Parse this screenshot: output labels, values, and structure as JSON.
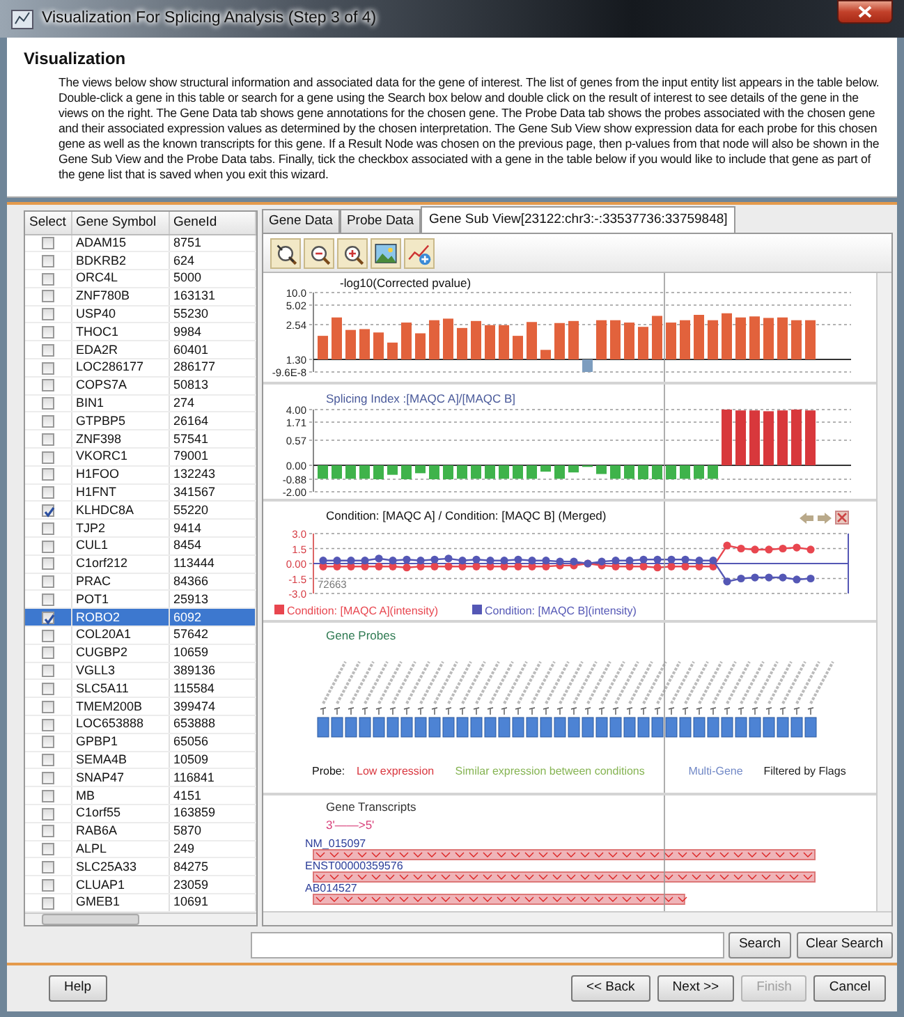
{
  "window": {
    "title": "Visualization For Splicing Analysis (Step 3 of 4)"
  },
  "header": {
    "title": "Visualization",
    "description": "The views below show structural information and associated data for the gene of interest. The list of genes from the input entity list appears in the table below. Double-click a gene in this table or search for a gene using the Search box below and double click on the result of interest to see details of the gene in the views on the right. The Gene Data tab shows gene annotations for the chosen gene. The Probe Data tab shows the probes associated with the chosen gene and their associated expression values as determined by the chosen interpretation. The Gene Sub View show expression data for each probe for this chosen gene as well as the known transcripts for this gene. If a Result Node was chosen on the previous page, then p-values from that node will also be shown in the Gene Sub View and the Probe Data tabs. Finally, tick the checkbox associated with a gene in the table below if you would like to include that gene as part of the gene list that is saved when you exit this wizard."
  },
  "gene_table": {
    "columns": [
      "Select",
      "Gene Symbol",
      "GeneId"
    ],
    "rows": [
      {
        "symbol": "ADAM15",
        "gene_id": "8751",
        "checked": false,
        "selected": false
      },
      {
        "symbol": "BDKRB2",
        "gene_id": "624",
        "checked": false,
        "selected": false
      },
      {
        "symbol": "ORC4L",
        "gene_id": "5000",
        "checked": false,
        "selected": false
      },
      {
        "symbol": "ZNF780B",
        "gene_id": "163131",
        "checked": false,
        "selected": false
      },
      {
        "symbol": "USP40",
        "gene_id": "55230",
        "checked": false,
        "selected": false
      },
      {
        "symbol": "THOC1",
        "gene_id": "9984",
        "checked": false,
        "selected": false
      },
      {
        "symbol": "EDA2R",
        "gene_id": "60401",
        "checked": false,
        "selected": false
      },
      {
        "symbol": "LOC286177",
        "gene_id": "286177",
        "checked": false,
        "selected": false
      },
      {
        "symbol": "COPS7A",
        "gene_id": "50813",
        "checked": false,
        "selected": false
      },
      {
        "symbol": "BIN1",
        "gene_id": "274",
        "checked": false,
        "selected": false
      },
      {
        "symbol": "GTPBP5",
        "gene_id": "26164",
        "checked": false,
        "selected": false
      },
      {
        "symbol": "ZNF398",
        "gene_id": "57541",
        "checked": false,
        "selected": false
      },
      {
        "symbol": "VKORC1",
        "gene_id": "79001",
        "checked": false,
        "selected": false
      },
      {
        "symbol": "H1FOO",
        "gene_id": "132243",
        "checked": false,
        "selected": false
      },
      {
        "symbol": "H1FNT",
        "gene_id": "341567",
        "checked": false,
        "selected": false
      },
      {
        "symbol": "KLHDC8A",
        "gene_id": "55220",
        "checked": true,
        "selected": false
      },
      {
        "symbol": "TJP2",
        "gene_id": "9414",
        "checked": false,
        "selected": false
      },
      {
        "symbol": "CUL1",
        "gene_id": "8454",
        "checked": false,
        "selected": false
      },
      {
        "symbol": "C1orf212",
        "gene_id": "113444",
        "checked": false,
        "selected": false
      },
      {
        "symbol": "PRAC",
        "gene_id": "84366",
        "checked": false,
        "selected": false
      },
      {
        "symbol": "POT1",
        "gene_id": "25913",
        "checked": false,
        "selected": false
      },
      {
        "symbol": "ROBO2",
        "gene_id": "6092",
        "checked": true,
        "selected": true
      },
      {
        "symbol": "COL20A1",
        "gene_id": "57642",
        "checked": false,
        "selected": false
      },
      {
        "symbol": "CUGBP2",
        "gene_id": "10659",
        "checked": false,
        "selected": false
      },
      {
        "symbol": "VGLL3",
        "gene_id": "389136",
        "checked": false,
        "selected": false
      },
      {
        "symbol": "SLC5A11",
        "gene_id": "115584",
        "checked": false,
        "selected": false
      },
      {
        "symbol": "TMEM200B",
        "gene_id": "399474",
        "checked": false,
        "selected": false
      },
      {
        "symbol": "LOC653888",
        "gene_id": "653888",
        "checked": false,
        "selected": false
      },
      {
        "symbol": "GPBP1",
        "gene_id": "65056",
        "checked": false,
        "selected": false
      },
      {
        "symbol": "SEMA4B",
        "gene_id": "10509",
        "checked": false,
        "selected": false
      },
      {
        "symbol": "SNAP47",
        "gene_id": "116841",
        "checked": false,
        "selected": false
      },
      {
        "symbol": "MB",
        "gene_id": "4151",
        "checked": false,
        "selected": false
      },
      {
        "symbol": "C1orf55",
        "gene_id": "163859",
        "checked": false,
        "selected": false
      },
      {
        "symbol": "RAB6A",
        "gene_id": "5870",
        "checked": false,
        "selected": false
      },
      {
        "symbol": "ALPL",
        "gene_id": "249",
        "checked": false,
        "selected": false
      },
      {
        "symbol": "SLC25A33",
        "gene_id": "84275",
        "checked": false,
        "selected": false
      },
      {
        "symbol": "CLUAP1",
        "gene_id": "23059",
        "checked": false,
        "selected": false
      },
      {
        "symbol": "GMEB1",
        "gene_id": "10691",
        "checked": false,
        "selected": false
      }
    ]
  },
  "tabs": [
    {
      "label": "Gene Data",
      "selected": false
    },
    {
      "label": "Probe Data",
      "selected": false
    },
    {
      "label": "Gene Sub View[23122:chr3:-:33537736:33759848]",
      "selected": true
    }
  ],
  "panes": [
    {
      "kind": "bar",
      "title": "-log10(Corrected pvalue)",
      "axis_labels": [
        "10.0",
        "5.02",
        "2.54",
        "1.30",
        "-9.6E-8"
      ]
    },
    {
      "kind": "bar",
      "title": "Splicing Index :[MAQC A]/[MAQC B]",
      "axis_labels": [
        "4.00",
        "1.71",
        "0.57",
        "0.00",
        "-0.88",
        "-2.00"
      ]
    },
    {
      "kind": "line",
      "note": "72663",
      "chart_data": {
        "type": "line",
        "title": "Condition: [MAQC A] / Condition: [MAQC B] (Merged)",
        "ylim": [
          -3.0,
          3.0
        ],
        "grid": true,
        "legend": true,
        "series": [
          {
            "name": "Condition: [MAQC A](intensity)",
            "color": "#e8464f",
            "marker": "o",
            "values": [
              -0.3,
              -0.3,
              -0.3,
              -0.3,
              -0.3,
              -0.3,
              -0.4,
              -0.3,
              -0.3,
              -0.3,
              -0.3,
              -0.3,
              -0.3,
              -0.3,
              -0.3,
              -0.3,
              -0.3,
              -0.2,
              -0.2,
              0.0,
              -0.2,
              -0.3,
              -0.3,
              -0.3,
              -0.4,
              -0.3,
              -0.3,
              -0.3,
              -0.3,
              1.8,
              1.5,
              1.4,
              1.4,
              1.5,
              1.6,
              1.4
            ]
          },
          {
            "name": "Condition: [MAQC B](intensity)",
            "color": "#5457b5",
            "marker": "o",
            "values": [
              0.3,
              0.3,
              0.3,
              0.3,
              0.5,
              0.3,
              0.4,
              0.3,
              0.4,
              0.5,
              0.3,
              0.4,
              0.3,
              0.3,
              0.4,
              0.3,
              0.3,
              0.2,
              0.2,
              0.0,
              0.2,
              0.3,
              0.3,
              0.4,
              0.4,
              0.4,
              0.4,
              0.3,
              0.3,
              -1.8,
              -1.5,
              -1.4,
              -1.4,
              -1.4,
              -1.6,
              -1.5
            ]
          }
        ],
        "ref_lines": [
          {
            "axis": "y",
            "value": 0,
            "color": "#5457b5"
          }
        ],
        "yticks": [
          {
            "value": 3.0,
            "label": "3.0"
          },
          {
            "value": 1.5,
            "label": "1.5"
          },
          {
            "value": 0,
            "label": "0.00"
          },
          {
            "value": -1.5,
            "label": "-1.5"
          },
          {
            "value": -3.0,
            "label": "-3.0"
          }
        ]
      }
    },
    {
      "kind": "probes",
      "title": "Gene Probes",
      "legend_label": "Probe:",
      "legend": [
        {
          "label": "Low expression",
          "color": "#d9363e"
        },
        {
          "label": "Similar expression between conditions",
          "color": "#86b453"
        },
        {
          "label": "Multi-Gene",
          "color": "#7188c6"
        },
        {
          "label": "Filtered by Flags",
          "color": "#222222"
        }
      ]
    },
    {
      "kind": "transcripts",
      "title": "Gene Transcripts",
      "direction": "3'——>5'",
      "transcripts": [
        {
          "name": "NM_015097",
          "partial": false
        },
        {
          "name": "ENST00000359576",
          "partial": false
        },
        {
          "name": "AB014527",
          "partial": true
        }
      ]
    }
  ],
  "search": {
    "buttons": [
      "Search",
      "Clear Search"
    ]
  },
  "footer": {
    "buttons": [
      {
        "label": "Help",
        "disabled": false
      },
      {
        "label": "<< Back",
        "disabled": false
      },
      {
        "label": "Next >>",
        "disabled": false
      },
      {
        "label": "Finish",
        "disabled": true
      },
      {
        "label": "Cancel",
        "disabled": false
      }
    ]
  }
}
